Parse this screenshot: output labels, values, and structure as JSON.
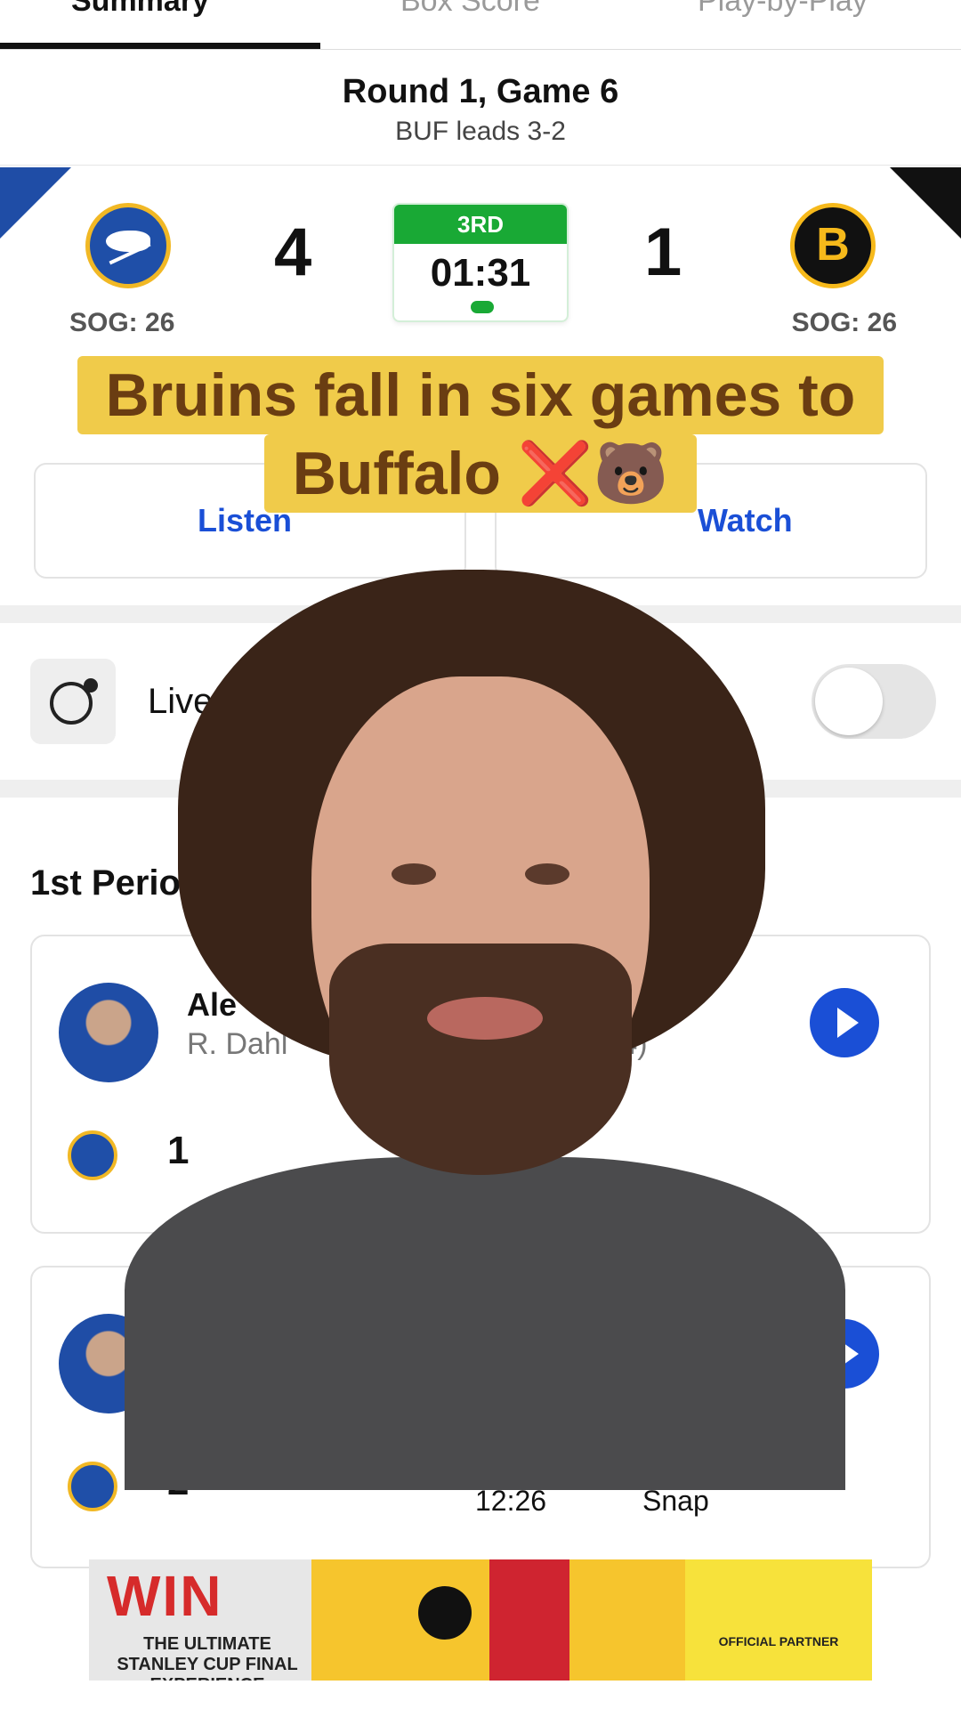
{
  "tabs": [
    {
      "label": "Summary"
    },
    {
      "label": "Box Score"
    },
    {
      "label": "Play-by-Play"
    }
  ],
  "round": {
    "title": "Round 1, Game 6",
    "subtitle": "BUF leads 3-2"
  },
  "scoreboard": {
    "home": {
      "abbr": "BUF",
      "score": "4",
      "sog": "SOG: 26"
    },
    "away": {
      "abbr": "BOS",
      "score": "1",
      "sog": "SOG: 26",
      "logo_letter": "B"
    },
    "period": "3RD",
    "clock": "01:31"
  },
  "caption": {
    "line1": "Bruins fall in six games to",
    "line2": "Buffalo ❌🐻"
  },
  "actions": {
    "listen": "Listen",
    "watch": "Watch"
  },
  "live": {
    "label": "Live"
  },
  "section": {
    "heading": "1st Period"
  },
  "goals": [
    {
      "scorer": "Ale",
      "assists": "R. Dahl",
      "goal_count": "(4)",
      "score": "1",
      "time": "",
      "type": ""
    },
    {
      "scorer": "",
      "assists": "",
      "goal_count": "",
      "score": "2",
      "time": "12:26",
      "type": "Snap"
    }
  ],
  "ad": {
    "headline": "WIN",
    "subline": "THE ULTIMATE STANLEY CUP FINAL EXPERIENCE",
    "partner": "OFFICIAL PARTNER"
  },
  "colors": {
    "accent_blue": "#1a4fd6",
    "period_green": "#19a935",
    "caption_bg": "#f0cb4a",
    "caption_text": "#6a3d12"
  }
}
